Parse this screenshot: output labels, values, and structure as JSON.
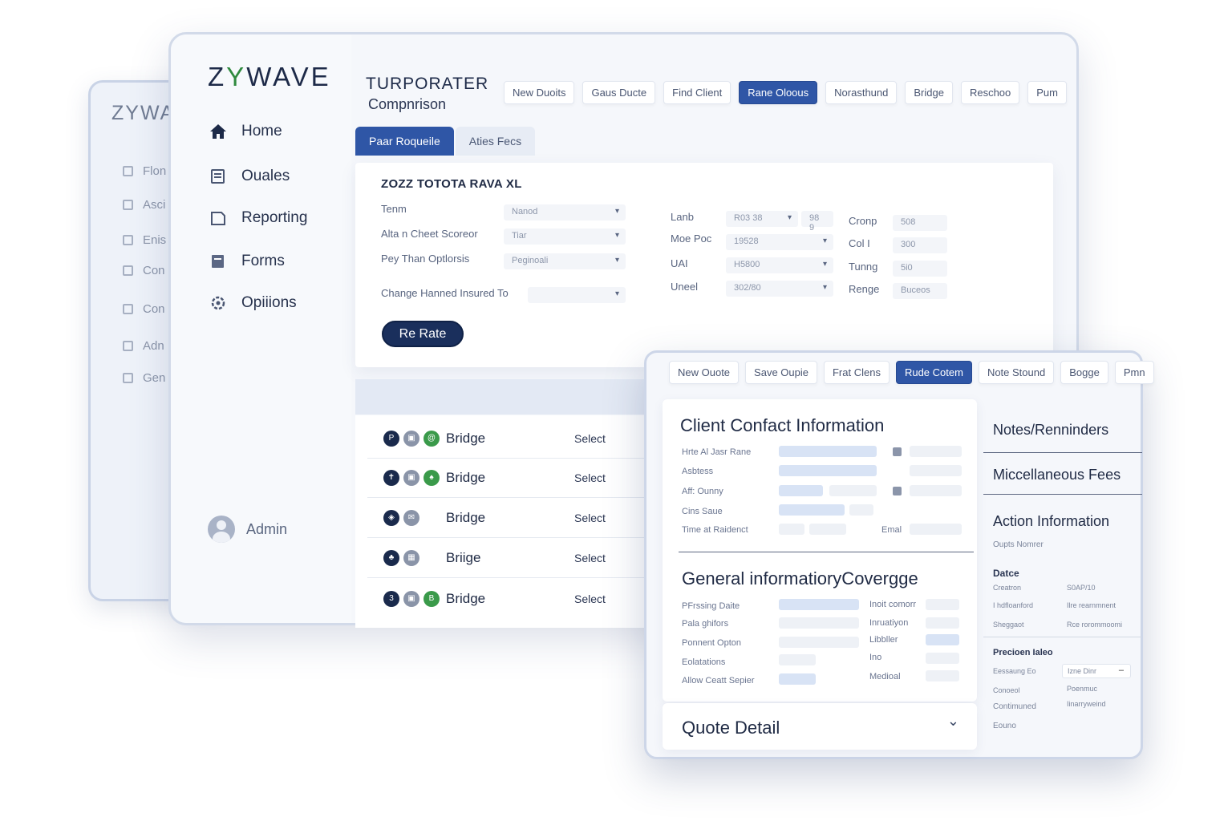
{
  "back_window": {
    "logo": "ZYWA",
    "items": [
      "Flon",
      "Asci",
      "Enis",
      "Con",
      "Con",
      "Adn",
      "Gen"
    ]
  },
  "sidebar": {
    "logo_prefix": "Z",
    "logo_y": "Y",
    "logo_rest": "WAVE",
    "items": [
      {
        "label": "Home",
        "icon": "home-icon"
      },
      {
        "label": "Ouales",
        "icon": "quotes-icon"
      },
      {
        "label": "Reporting",
        "icon": "reporting-icon"
      },
      {
        "label": "Forms",
        "icon": "forms-icon"
      },
      {
        "label": "Opiiions",
        "icon": "options-icon"
      }
    ],
    "admin": "Admin"
  },
  "header": {
    "title": "TURPORATER",
    "subtitle": "Compnrison"
  },
  "toolbar_main": [
    "New Duoits",
    "Gaus Ducte",
    "Find Client",
    "Rane Oloous",
    "Norasthund",
    "Bridge",
    "Reschoo",
    "Pum"
  ],
  "toolbar_main_active": "Rane Oloous",
  "tabs": [
    "Paar Roqueile",
    "Aties Fecs"
  ],
  "rate_card": {
    "title": "ZOZZ TOTOTA RAVA XL",
    "left_fields": [
      {
        "label": "Tenm",
        "value": "Nanod"
      },
      {
        "label": "Alta n Cheet Scoreor",
        "value": "Tiar"
      },
      {
        "label": "Pey Than Optlorsis",
        "value": "Peginoali"
      },
      {
        "label": "Change Hanned Insured To",
        "value": ""
      }
    ],
    "mid_fields": [
      {
        "label": "Lanb",
        "value": "R03 38",
        "extra": "98 9"
      },
      {
        "label": "Moe Poc",
        "value": "19528"
      },
      {
        "label": "UAI",
        "value": "H5800"
      },
      {
        "label": "Uneel",
        "value": "302/80"
      }
    ],
    "right_fields": [
      {
        "label": "Cronp",
        "value": "508"
      },
      {
        "label": "Col I",
        "value": "300"
      },
      {
        "label": "Tunng",
        "value": "5i0"
      },
      {
        "label": "Renge",
        "value": "Buceos"
      }
    ],
    "rerate_label": "Re Rate"
  },
  "list_rows": [
    {
      "name": "Bridge",
      "action": "Select"
    },
    {
      "name": "Bridge",
      "action": "Select"
    },
    {
      "name": "Bridge",
      "action": "Select"
    },
    {
      "name": "Briige",
      "action": "Select"
    },
    {
      "name": "Bridge",
      "action": "Select"
    }
  ],
  "toolbar_front": [
    "New Ouote",
    "Save Oupie",
    "Frat Clens",
    "Rude Cotem",
    "Note Stound",
    "Bogge",
    "Pmn"
  ],
  "toolbar_front_active": "Rude Cotem",
  "client_contact": {
    "title": "Client Confact Information",
    "fields": [
      "Hrte Al Jasr Rane",
      "Asbtess",
      "Aff: Ounny",
      "Cins Saue",
      "Time at Raidenct"
    ],
    "emal": "Emal"
  },
  "general_info": {
    "title": "General informatioryCovergge",
    "left_fields": [
      "PFrssing Daite",
      "Pala ghifors",
      "Ponnent Opton",
      "Eolatations",
      "Allow Ceatt Sepier"
    ],
    "right_fields": [
      "Inoit comorr",
      "Inruatiyon",
      "Libbller",
      "Ino",
      "Medioal"
    ]
  },
  "quote_detail": "Quote Detail",
  "right_pane": {
    "notes": "Notes/Renninders",
    "misc": "Miccellaneous Fees",
    "action": "Action Information",
    "action_sub": "Oupts Nomrer",
    "date_label": "Datce",
    "date_rows": [
      {
        "k": "Creatron",
        "v": "S0AP/10"
      },
      {
        "k": "I hdfloanford",
        "v": "Ilre rearnmnent"
      },
      {
        "k": "Sheggaot",
        "v": "Rce rorommoomi"
      }
    ],
    "precision_label": "Precioen Ialeo",
    "precision_rows": [
      {
        "k": "Eessaung Eo",
        "v": "Izne Dinr"
      },
      {
        "k": "Conoeol",
        "v": "Poenmuc"
      },
      {
        "k": "Contimuned",
        "v": "Iinarryweind"
      },
      {
        "k": "Eouno",
        "v": ""
      }
    ]
  }
}
